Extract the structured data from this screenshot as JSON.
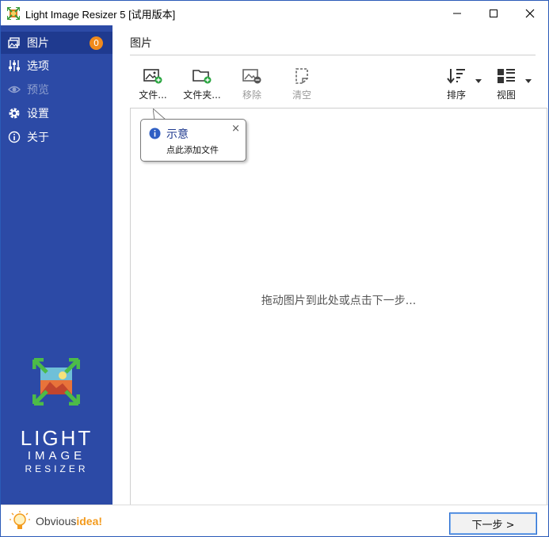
{
  "window": {
    "title": "Light Image Resizer 5  [试用版本]"
  },
  "sidebar": {
    "items": [
      {
        "label": "图片",
        "icon": "images-icon",
        "badge": "0",
        "active": true
      },
      {
        "label": "选项",
        "icon": "sliders-icon"
      },
      {
        "label": "预览",
        "icon": "eye-icon",
        "disabled": true
      },
      {
        "label": "设置",
        "icon": "gear-icon"
      },
      {
        "label": "关于",
        "icon": "info-icon"
      }
    ],
    "logo_lines": [
      "LIGHT",
      "IMAGE",
      "RESIZER"
    ],
    "brand_prefix": "Obvious",
    "brand_suffix": "idea!"
  },
  "main": {
    "title": "图片",
    "toolbar": {
      "file_label": "文件...",
      "folder_label": "文件夹...",
      "remove_label": "移除",
      "clear_label": "清空",
      "sort_label": "排序",
      "view_label": "视图"
    },
    "drop_hint": "拖动图片到此处或点击下一步...",
    "tooltip": {
      "title": "示意",
      "body": "点此添加文件",
      "close": "×"
    },
    "next_button": "下一步 >"
  },
  "colors": {
    "sidebar_bg": "#2c4aa6",
    "sidebar_active": "#1f3a8f",
    "badge": "#f08a1c",
    "accent_green": "#2aa640"
  }
}
